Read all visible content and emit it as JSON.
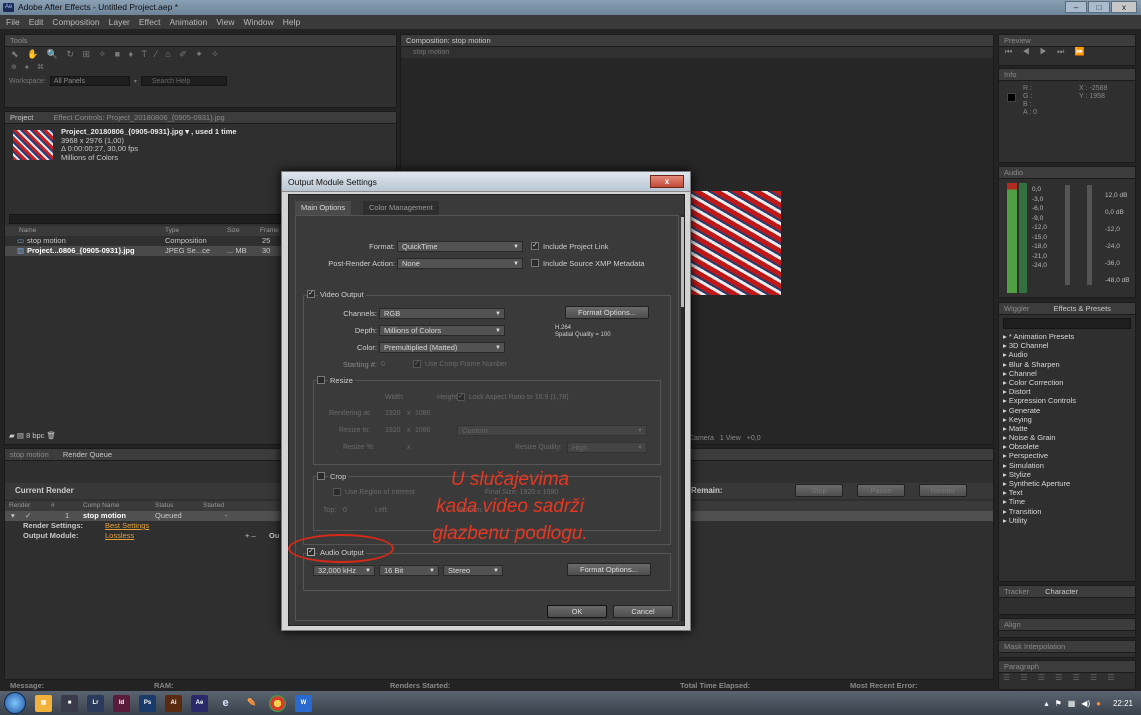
{
  "window": {
    "title": "Adobe After Effects - Untitled Project.aep *",
    "app_badge": "Ae",
    "minimize": "–",
    "maximize": "□",
    "close": "x"
  },
  "menu": [
    "File",
    "Edit",
    "Composition",
    "Layer",
    "Effect",
    "Animation",
    "View",
    "Window",
    "Help"
  ],
  "tools_panel": {
    "title": "Tools",
    "workspace_label": "Workspace:",
    "workspace_value": "All Panels",
    "search_placeholder": "Search Help"
  },
  "project_panel": {
    "tab_project": "Project",
    "tab_effect_controls": "Effect Controls: Project_20180806_{0905-0931}.jpg",
    "footage_name": "Project_20180806_{0905-0931}.jpg ▾ , used 1 time",
    "footage_dims": "3968 x 2976 (1,00)",
    "footage_duration": "Δ 0:00:00:27, 30,00 fps",
    "footage_colors": "Millions of Colors",
    "columns": [
      "Name",
      "Type",
      "Size",
      "Frame"
    ],
    "rows": [
      {
        "name": "stop motion",
        "type": "Composition",
        "size": "",
        "frame": "25"
      },
      {
        "name": "Project...0806_{0905-0931}.jpg",
        "type": "JPEG Se...ce",
        "size": "... MB",
        "frame": "30"
      }
    ],
    "bpc": "8 bpc"
  },
  "composition_panel": {
    "tab": "Composition: stop motion",
    "sub_tab": "stop motion",
    "camera": "Camera",
    "view": "1 View",
    "exposure": "+0,0"
  },
  "render_queue": {
    "tab_stop_motion": "stop motion",
    "tab_render_queue": "Render Queue",
    "current_render": "Current Render",
    "elapsed_remain": "Remain:",
    "buttons": [
      "Stop",
      "Pause",
      "Render"
    ],
    "columns": [
      "Render",
      "#",
      "Comp Name",
      "Status",
      "Started"
    ],
    "item_number": "1",
    "item_comp": "stop motion",
    "item_status": "Queued",
    "item_started": "-",
    "render_settings_label": "Render Settings:",
    "render_settings_value": "Best Settings",
    "output_module_label": "Output Module:",
    "output_module_value": "Lossless",
    "output_to": "Ou"
  },
  "status_bar": {
    "message": "Message:",
    "ram": "RAM:",
    "renders_started": "Renders Started:",
    "total_elapsed": "Total Time Elapsed:",
    "recent_error": "Most Recent Error:"
  },
  "preview_panel": {
    "title": "Preview"
  },
  "info_panel": {
    "title": "Info",
    "r": "R :",
    "g": "G :",
    "b": "B :",
    "a": "A : 0",
    "x": "X : -2588",
    "y": "Y : 1958"
  },
  "audio_panel": {
    "title": "Audio",
    "left_scale": [
      "0,0",
      "-3,0",
      "-6,0",
      "-9,0",
      "-12,0",
      "-15,0",
      "-18,0",
      "-21,0",
      "-24,0"
    ],
    "right_scale": [
      "12,0 dB",
      "0,0 dB",
      "-12,0",
      "-24,0",
      "-36,0",
      "-48,0 dB"
    ]
  },
  "effects_panel": {
    "tab_wiggler": "Wiggler",
    "tab_effects": "Effects & Presets",
    "items": [
      "* Animation Presets",
      "3D Channel",
      "Audio",
      "Blur & Sharpen",
      "Channel",
      "Color Correction",
      "Distort",
      "Expression Controls",
      "Generate",
      "Keying",
      "Matte",
      "Noise & Grain",
      "Obsolete",
      "Perspective",
      "Simulation",
      "Stylize",
      "Synthetic Aperture",
      "Text",
      "Time",
      "Transition",
      "Utility"
    ]
  },
  "lower_right_panels": {
    "tracker": "Tracker",
    "character": "Character",
    "align": "Align",
    "mask_interp": "Mask Interpolation",
    "paragraph": "Paragraph"
  },
  "dialog": {
    "title": "Output Module Settings",
    "close": "x",
    "tabs": [
      "Main Options",
      "Color Management"
    ],
    "format_label": "Format:",
    "format_value": "QuickTime",
    "include_project_link": "Include Project Link",
    "post_render_label": "Post-Render Action:",
    "post_render_value": "None",
    "include_xmp": "Include Source XMP Metadata",
    "video_output_label": "Video Output",
    "channels_label": "Channels:",
    "channels_value": "RGB",
    "format_options": "Format Options...",
    "depth_label": "Depth:",
    "depth_value": "Millions of Colors",
    "codec_name": "H.264",
    "codec_quality": "Spatial Quality = 100",
    "color_label": "Color:",
    "color_value": "Premultiplied (Matted)",
    "starting_label": "Starting #:",
    "starting_value": "0",
    "use_comp_frame": "Use Comp Frame Number",
    "resize_label": "Resize",
    "width_label": "Width",
    "height_label": "Height",
    "lock_aspect": "Lock Aspect Ratio to 16:9 (1,78)",
    "rendering_at_label": "Rendering at:",
    "rendering_w": "1920",
    "rendering_h": "1080",
    "resize_to_label": "Resize to:",
    "resize_w": "1920",
    "resize_h": "1080",
    "resize_preset": "Custom",
    "resize_pct_label": "Resize %:",
    "resize_quality_label": "Resize Quality:",
    "resize_quality_value": "High",
    "crop_label": "Crop",
    "use_roi": "Use Region of Interest",
    "final_size": "Final Size: 1920 x 1080",
    "top_label": "Top:",
    "top_value": "0",
    "left_label": "Left:",
    "bottom_label": "Bottom:",
    "audio_output_label": "Audio Output",
    "sample_rate": "32,000 kHz",
    "bit_depth": "16 Bit",
    "channels_audio": "Stereo",
    "audio_format_options": "Format Options...",
    "ok": "OK",
    "cancel": "Cancel"
  },
  "annotation": {
    "line1": "U slučajevima",
    "line2": "kada video sadrži",
    "line3": "glazbenu podlogu.",
    "color": "#e8361f"
  },
  "taskbar": {
    "time": "22:21"
  }
}
